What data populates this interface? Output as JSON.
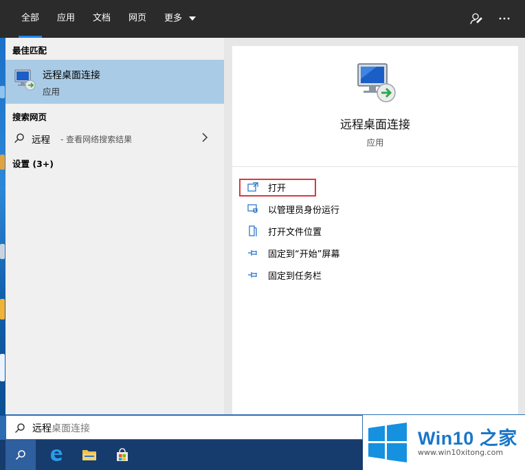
{
  "tabs": [
    {
      "label": "全部",
      "active": true
    },
    {
      "label": "应用",
      "active": false
    },
    {
      "label": "文档",
      "active": false
    },
    {
      "label": "网页",
      "active": false
    },
    {
      "label": "更多",
      "active": false
    }
  ],
  "top_icons": {
    "feedback": "feedback-icon",
    "more": "ellipsis-icon"
  },
  "left": {
    "best_match_label": "最佳匹配",
    "best_match": {
      "title": "远程桌面连接",
      "subtitle": "应用",
      "icon": "remote-desktop-icon"
    },
    "web_label": "搜索网页",
    "web_query": "远程",
    "web_hint": "- 查看网络搜索结果",
    "settings_label": "设置 (3+)"
  },
  "detail": {
    "title": "远程桌面连接",
    "type": "应用",
    "actions": [
      {
        "label": "打开",
        "icon": "open-icon"
      },
      {
        "label": "以管理员身份运行",
        "icon": "shield-icon"
      },
      {
        "label": "打开文件位置",
        "icon": "file-location-icon"
      },
      {
        "label": "固定到“开始”屏幕",
        "icon": "pin-icon"
      },
      {
        "label": "固定到任务栏",
        "icon": "pin-icon"
      }
    ]
  },
  "search": {
    "typed": "远程",
    "suggestion": "桌面连接"
  },
  "taskbar": [
    "search-icon",
    "edge-icon",
    "file-explorer-icon",
    "store-icon"
  ],
  "watermark": {
    "brand": "Win10 之家",
    "url": "www.win10xitong.com"
  },
  "colors": {
    "accent": "#1e88e5",
    "selection": "#a9cbe6",
    "highlight_border": "#d9383e",
    "taskbar": "#163b6d"
  }
}
